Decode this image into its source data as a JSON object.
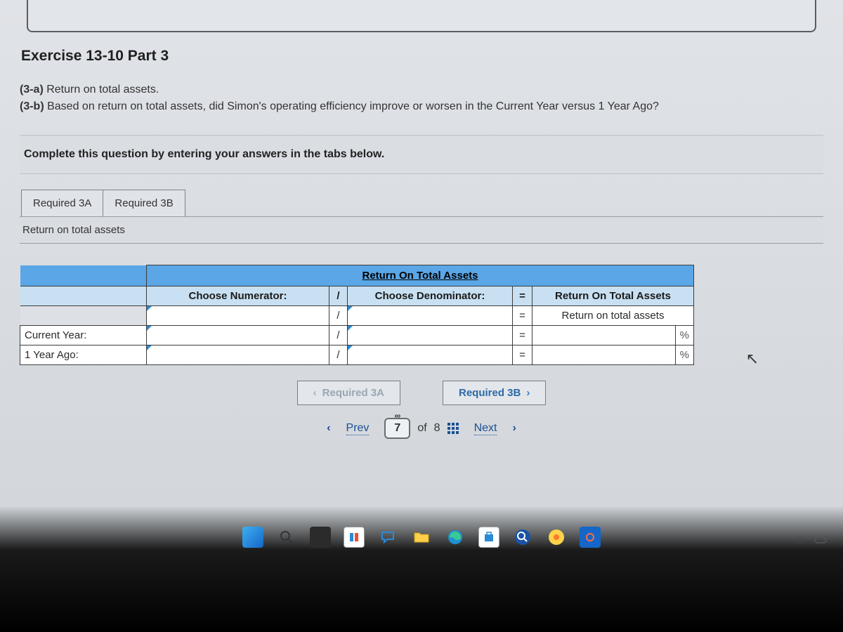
{
  "exercise": {
    "title": "Exercise 13-10 Part 3",
    "q_a_label": "(3-a)",
    "q_a_text": " Return on total assets.",
    "q_b_label": "(3-b)",
    "q_b_text": " Based on return on total assets, did Simon's operating efficiency improve or worsen in the Current Year versus 1 Year Ago?",
    "instruction": "Complete this question by entering your answers in the tabs below."
  },
  "tabs": {
    "tab_a": "Required 3A",
    "tab_b": "Required 3B",
    "panel_heading": "Return on total assets"
  },
  "table": {
    "title": "Return On Total Assets",
    "numerator_hdr": "Choose Numerator:",
    "denominator_hdr": "Choose Denominator:",
    "result_hdr": "Return On Total Assets",
    "result_sub": "Return on total assets",
    "slash": "/",
    "equals": "=",
    "pct": "%",
    "rows": {
      "current": "Current Year:",
      "year_ago": "1 Year Ago:"
    }
  },
  "stepnav": {
    "prev": "Required 3A",
    "next": "Required 3B"
  },
  "pager": {
    "prev": "Prev",
    "next": "Next",
    "page": "7",
    "of": "of",
    "total": "8"
  }
}
